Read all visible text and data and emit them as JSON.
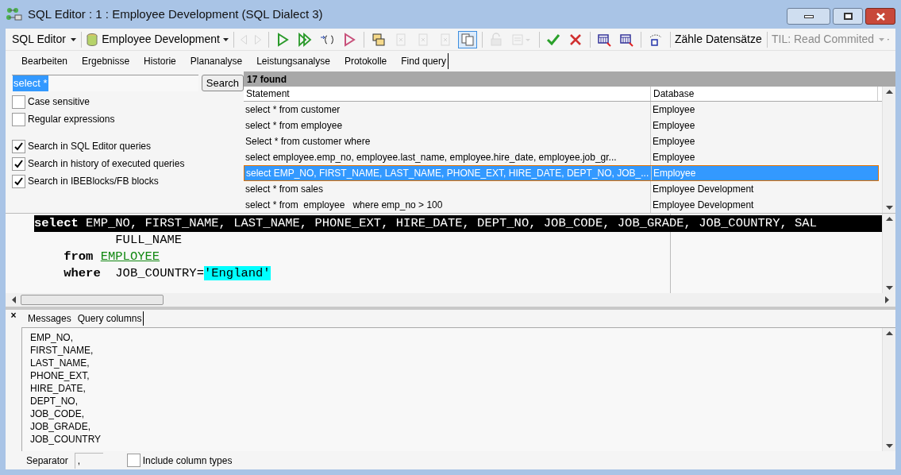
{
  "window": {
    "title": "SQL Editor : 1 : Employee Development (SQL Dialect 3)"
  },
  "toolbar": [
    {
      "kind": "menu",
      "label": "SQL Editor",
      "disabled": false
    },
    {
      "kind": "dbmenu",
      "label": "Employee Development",
      "disabled": false
    },
    {
      "kind": "icon",
      "disabled": true,
      "pressed": false
    },
    {
      "kind": "icon",
      "disabled": true,
      "pressed": false
    },
    {
      "kind": "icon",
      "disabled": false,
      "pressed": false
    },
    {
      "kind": "icon",
      "disabled": false,
      "pressed": false
    },
    {
      "kind": "icon",
      "disabled": false,
      "pressed": false
    },
    {
      "kind": "icon",
      "disabled": false,
      "pressed": false
    },
    {
      "kind": "icon",
      "disabled": false,
      "pressed": false
    },
    {
      "kind": "icon",
      "disabled": true,
      "pressed": false
    },
    {
      "kind": "icon",
      "disabled": true,
      "pressed": false
    },
    {
      "kind": "icon",
      "disabled": true,
      "pressed": false
    },
    {
      "kind": "icon",
      "disabled": false,
      "pressed": true
    },
    {
      "kind": "icon",
      "disabled": true,
      "pressed": false
    },
    {
      "kind": "icon",
      "disabled": true,
      "pressed": false
    },
    {
      "kind": "icon",
      "disabled": false,
      "pressed": false
    },
    {
      "kind": "icon",
      "disabled": false,
      "pressed": false
    },
    {
      "kind": "icon",
      "disabled": false,
      "pressed": false
    },
    {
      "kind": "icon",
      "disabled": false,
      "pressed": false
    },
    {
      "kind": "icon",
      "disabled": false,
      "pressed": false
    },
    {
      "kind": "text",
      "label": "Zähle Datensätze",
      "disabled": false
    },
    {
      "kind": "menu",
      "label": "TIL: Read Commited",
      "disabled": true
    }
  ],
  "tabs": [
    {
      "label": "Bearbeiten",
      "selected": false
    },
    {
      "label": "Ergebnisse",
      "selected": false
    },
    {
      "label": "Historie",
      "selected": false
    },
    {
      "label": "Plananalyse",
      "selected": false
    },
    {
      "label": "Leistungsanalyse",
      "selected": false
    },
    {
      "label": "Protokolle",
      "selected": false
    },
    {
      "label": "Find query",
      "selected": true
    }
  ],
  "search": {
    "value": "select *",
    "button": "Search",
    "options": [
      {
        "label": "Case sensitive",
        "checked": false
      },
      {
        "label": "Regular expressions",
        "checked": false
      }
    ],
    "scopes": [
      {
        "label": "Search in SQL Editor queries",
        "checked": true
      },
      {
        "label": "Search in history of executed queries",
        "checked": true
      },
      {
        "label": "Search in IBEBlocks/FB blocks",
        "checked": true
      }
    ]
  },
  "results": {
    "count": "17 found",
    "columns": [
      "Statement",
      "Database"
    ],
    "rows": [
      {
        "statement": "select * from customer",
        "database": "Employee",
        "selected": false
      },
      {
        "statement": "select * from employee",
        "database": "Employee",
        "selected": false
      },
      {
        "statement": "Select * from customer where",
        "database": "Employee",
        "selected": false
      },
      {
        "statement": "select employee.emp_no, employee.last_name, employee.hire_date, employee.job_gr...",
        "database": "Employee",
        "selected": false
      },
      {
        "statement": "select EMP_NO, FIRST_NAME, LAST_NAME, PHONE_EXT, HIRE_DATE, DEPT_NO, JOB_...",
        "database": "Employee",
        "selected": true
      },
      {
        "statement": "select * from sales",
        "database": "Employee Development",
        "selected": false
      },
      {
        "statement": "select * from  employee   where emp_no > 100",
        "database": "Employee Development",
        "selected": false
      }
    ]
  },
  "editor": {
    "lines": [
      {
        "current": true,
        "tokens": [
          {
            "kind": "keyword",
            "text": "select"
          },
          {
            "kind": "plain",
            "text": " EMP_NO, FIRST_NAME, LAST_NAME, PHONE_EXT, HIRE_DATE, DEPT_NO, JOB_CODE, JOB_GRADE, JOB_COUNTRY, SAL"
          }
        ]
      },
      {
        "current": false,
        "tokens": [
          {
            "kind": "plain",
            "text": "           FULL_NAME"
          }
        ]
      },
      {
        "current": false,
        "tokens": [
          {
            "kind": "keyword",
            "text": "    from "
          },
          {
            "kind": "table",
            "text": "EMPLOYEE"
          }
        ]
      },
      {
        "current": false,
        "tokens": [
          {
            "kind": "keyword",
            "text": "    where"
          },
          {
            "kind": "plain",
            "text": "  JOB_COUNTRY="
          },
          {
            "kind": "string",
            "text": "'England'"
          }
        ]
      }
    ]
  },
  "bottom": {
    "close": "×",
    "tabs": [
      {
        "label": "Messages",
        "selected": false
      },
      {
        "label": "Query columns",
        "selected": true
      }
    ],
    "columns": [
      "EMP_NO,",
      "FIRST_NAME,",
      "LAST_NAME,",
      "PHONE_EXT,",
      "HIRE_DATE,",
      "DEPT_NO,",
      "JOB_CODE,",
      "JOB_GRADE,",
      "JOB_COUNTRY"
    ],
    "separator_label": "Separator",
    "separator_value": ",",
    "include_types": {
      "label": "Include column types",
      "checked": false
    }
  }
}
